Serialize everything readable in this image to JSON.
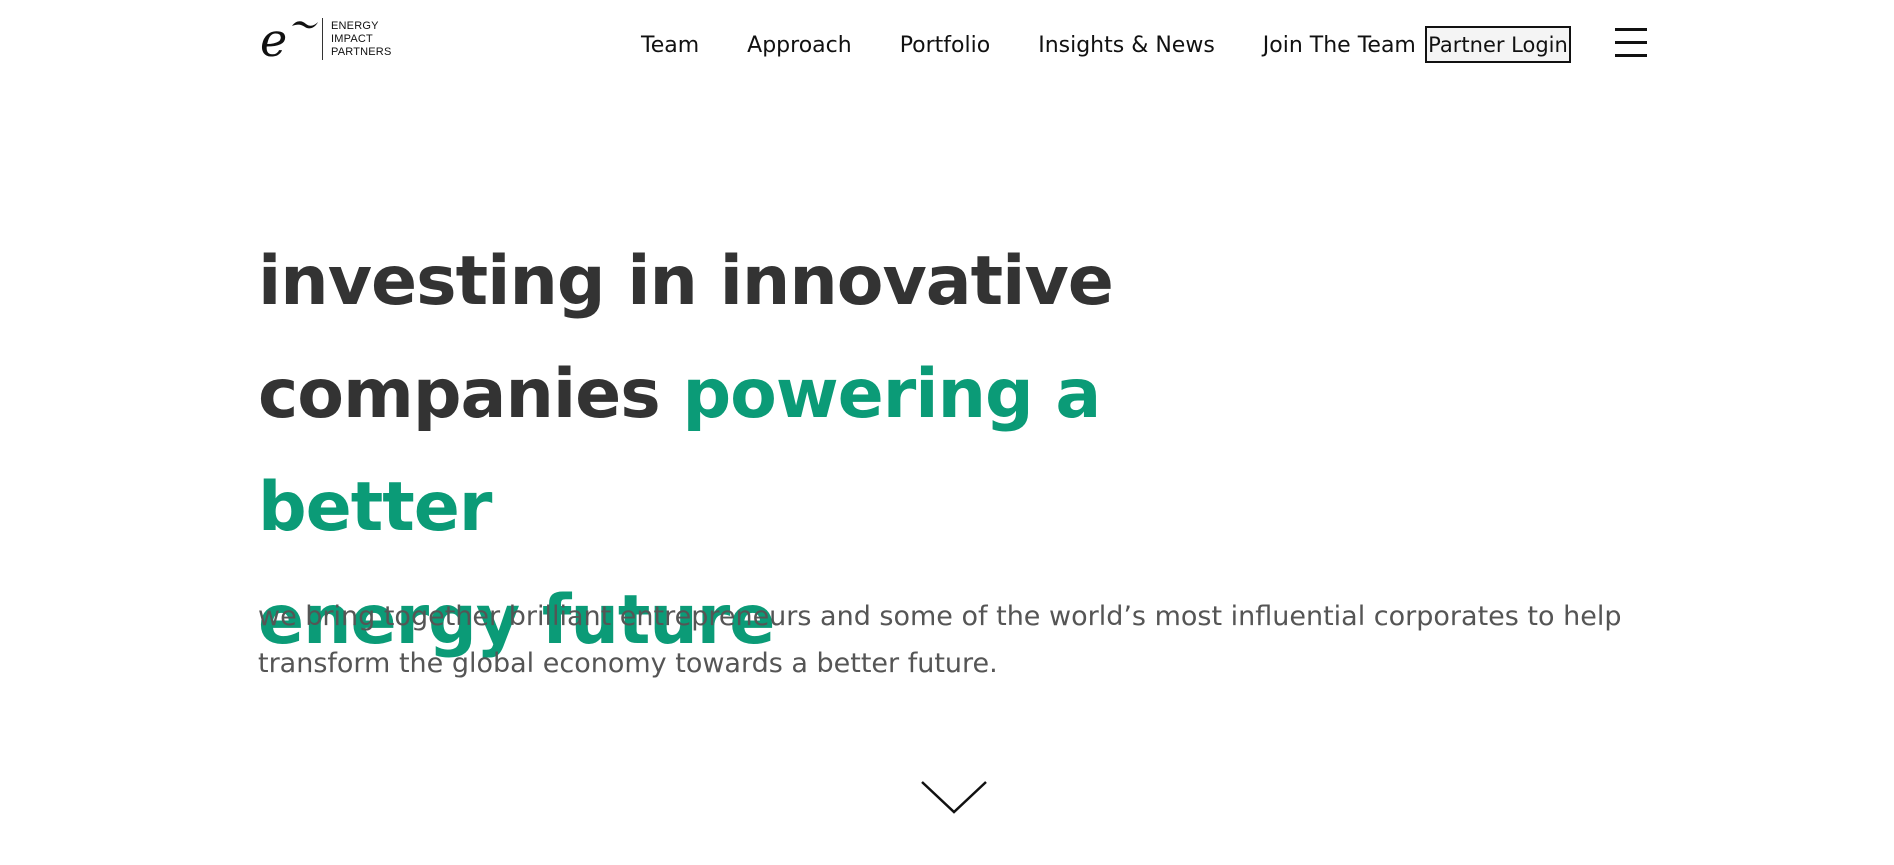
{
  "header": {
    "logo": {
      "mark": "e",
      "text": "ENERGY\nIMPACT\nPARTNERS"
    },
    "nav": [
      {
        "label": "Team"
      },
      {
        "label": "Approach"
      },
      {
        "label": "Portfolio"
      },
      {
        "label": "Insights & News"
      },
      {
        "label": "Join The Team"
      }
    ],
    "partner_login": "Partner Login",
    "menu_icon": "hamburger-menu-icon"
  },
  "hero": {
    "line1": "investing in innovative",
    "line2_dark": "companies ",
    "line2_accent": "powering a better",
    "line3_accent": "energy future"
  },
  "subheading": "we bring together brilliant entrepreneurs and some of the world’s most influential corporates to help transform the global economy towards a better future.",
  "scroll_icon": "chevron-down-icon",
  "colors": {
    "accent": "#0b9b77",
    "heading": "#333333",
    "body_text": "#555555"
  }
}
